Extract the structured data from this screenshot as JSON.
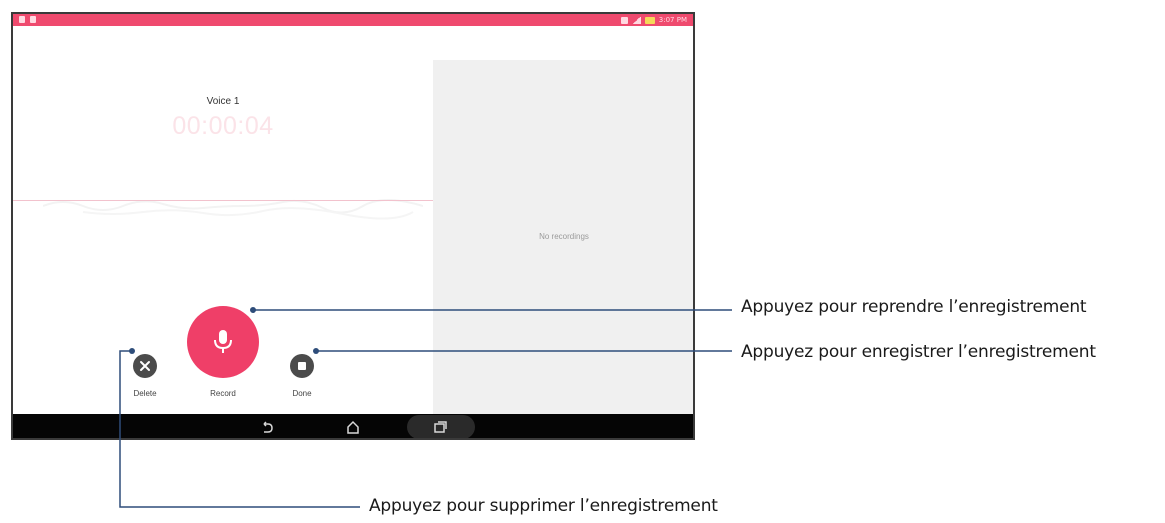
{
  "recorder": {
    "title": "Voice 1",
    "timer": "00:00:04",
    "controls": {
      "delete_label": "Delete",
      "record_label": "Record",
      "done_label": "Done"
    }
  },
  "list": {
    "empty_text": "No recordings"
  },
  "status_bar": {
    "time": "3:07 PM"
  },
  "callouts": {
    "resume": "Appuyez pour reprendre l’enregistrement",
    "save": "Appuyez pour enregistrer l’enregistrement",
    "delete": "Appuyez pour supprimer l’enregistrement"
  },
  "colors": {
    "accent": "#ef3f68",
    "status_bar": "#ef4a6e",
    "callout_line": "#2e4d7a",
    "button_dark": "#4b4b4b"
  },
  "icons": {
    "record": "microphone-icon",
    "delete": "close-icon",
    "done": "stop-icon",
    "nav_back": "back-icon",
    "nav_home": "home-icon",
    "nav_recents": "recents-icon"
  }
}
